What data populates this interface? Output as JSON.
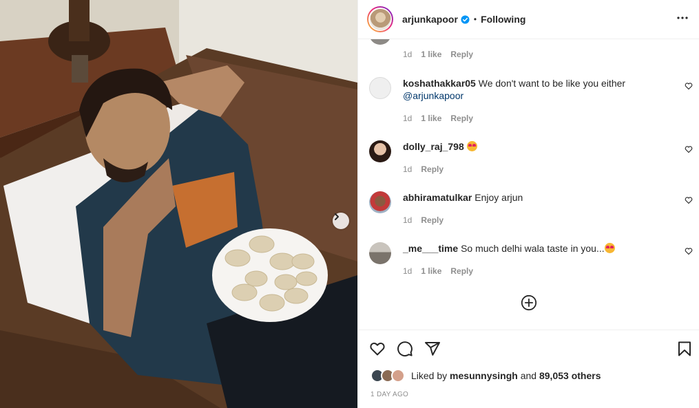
{
  "post": {
    "username": "arjunkapoor",
    "separator": "•",
    "follow_state": "Following",
    "verified": true,
    "image_alt": "Man reclining on a brown sofa holding a plate of momos"
  },
  "comments": [
    {
      "user": "",
      "text": "",
      "time": "1d",
      "likes": "1 like",
      "reply": "Reply"
    },
    {
      "user": "koshathakkar05",
      "text": "We don't want to be like you either",
      "mention": "@arjunkapoor",
      "time": "1d",
      "likes": "1 like",
      "reply": "Reply"
    },
    {
      "user": "dolly_raj_798",
      "text": "",
      "emoji": "heart-eyes-emoji",
      "time": "1d",
      "reply": "Reply"
    },
    {
      "user": "abhiramatulkar",
      "text": "Enjoy arjun",
      "time": "1d",
      "reply": "Reply"
    },
    {
      "user": "_me___time",
      "text": "So much delhi wala taste in you...",
      "emoji": "heart-eyes-emoji",
      "time": "1d",
      "likes": "1 like",
      "reply": "Reply"
    }
  ],
  "likes": {
    "prefix": "Liked by",
    "user": "mesunnysingh",
    "and": "and",
    "count": "89,053 others"
  },
  "date": "1 DAY AGO",
  "icons": {
    "verified": "verified-badge-icon",
    "more": "more-options-icon",
    "heart": "heart-icon",
    "comment": "comment-icon",
    "share": "share-icon",
    "save": "bookmark-icon",
    "load_more": "plus-circle-icon",
    "next": "chevron-right-icon"
  },
  "colors": {
    "verified_blue": "#0095f6",
    "mention": "#00376b",
    "meta_gray": "#8e8e8e"
  }
}
